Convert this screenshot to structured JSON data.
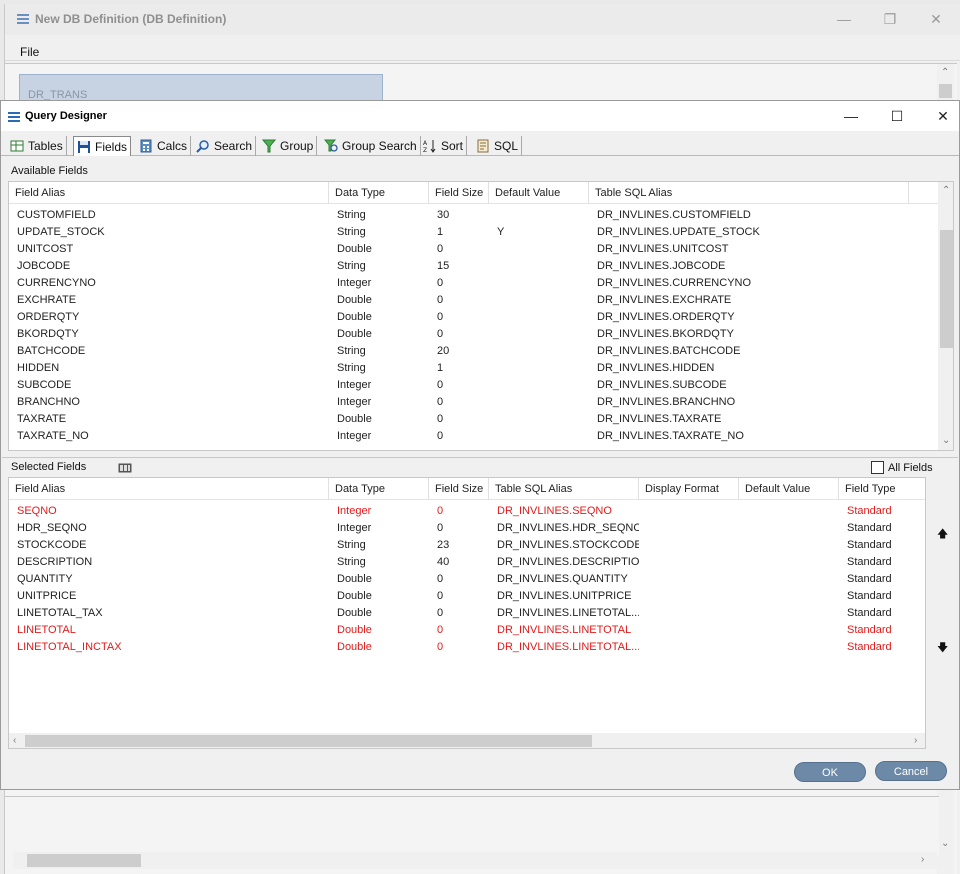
{
  "outer_window": {
    "title": "New DB Definition (DB Definition)",
    "menu_file": "File",
    "trans_box_text": "DR_TRANS"
  },
  "dialog": {
    "title": "Query Designer",
    "tabs": [
      {
        "label": "Tables",
        "icon": "tables-icon"
      },
      {
        "label": "Fields",
        "icon": "save-disk-icon"
      },
      {
        "label": "Calcs",
        "icon": "calculator-icon"
      },
      {
        "label": "Search",
        "icon": "magnifier-icon"
      },
      {
        "label": "Group",
        "icon": "filter-funnel-icon"
      },
      {
        "label": "Group Search",
        "icon": "filter-search-icon"
      },
      {
        "label": "Sort",
        "icon": "sort-az-icon"
      },
      {
        "label": "SQL",
        "icon": "sql-script-icon"
      }
    ],
    "active_tab": "Fields"
  },
  "available_fields": {
    "section_label": "Available Fields",
    "columns": [
      "Field Alias",
      "Data Type",
      "Field Size",
      "Default Value",
      "Table SQL Alias"
    ],
    "rows": [
      [
        "CUSTOMFIELD",
        "String",
        "30",
        "",
        "DR_INVLINES.CUSTOMFIELD"
      ],
      [
        "UPDATE_STOCK",
        "String",
        "1",
        "Y",
        "DR_INVLINES.UPDATE_STOCK"
      ],
      [
        "UNITCOST",
        "Double",
        "0",
        "",
        "DR_INVLINES.UNITCOST"
      ],
      [
        "JOBCODE",
        "String",
        "15",
        "",
        "DR_INVLINES.JOBCODE"
      ],
      [
        "CURRENCYNO",
        "Integer",
        "0",
        "",
        "DR_INVLINES.CURRENCYNO"
      ],
      [
        "EXCHRATE",
        "Double",
        "0",
        "",
        "DR_INVLINES.EXCHRATE"
      ],
      [
        "ORDERQTY",
        "Double",
        "0",
        "",
        "DR_INVLINES.ORDERQTY"
      ],
      [
        "BKORDQTY",
        "Double",
        "0",
        "",
        "DR_INVLINES.BKORDQTY"
      ],
      [
        "BATCHCODE",
        "String",
        "20",
        "",
        "DR_INVLINES.BATCHCODE"
      ],
      [
        "HIDDEN",
        "String",
        "1",
        "",
        "DR_INVLINES.HIDDEN"
      ],
      [
        "SUBCODE",
        "Integer",
        "0",
        "",
        "DR_INVLINES.SUBCODE"
      ],
      [
        "BRANCHNO",
        "Integer",
        "0",
        "",
        "DR_INVLINES.BRANCHNO"
      ],
      [
        "TAXRATE",
        "Double",
        "0",
        "",
        "DR_INVLINES.TAXRATE"
      ],
      [
        "TAXRATE_NO",
        "Integer",
        "0",
        "",
        "DR_INVLINES.TAXRATE_NO"
      ]
    ]
  },
  "selected_fields": {
    "section_label": "Selected Fields",
    "all_fields_label": "All Fields",
    "columns": [
      "Field Alias",
      "Data Type",
      "Field Size",
      "Table SQL Alias",
      "Display Format",
      "Default Value",
      "Field Type"
    ],
    "rows": [
      {
        "cells": [
          "SEQNO",
          "Integer",
          "0",
          "DR_INVLINES.SEQNO",
          "",
          "",
          "Standard"
        ],
        "highlight": true
      },
      {
        "cells": [
          "HDR_SEQNO",
          "Integer",
          "0",
          "DR_INVLINES.HDR_SEQNO",
          "",
          "",
          "Standard"
        ],
        "highlight": false
      },
      {
        "cells": [
          "STOCKCODE",
          "String",
          "23",
          "DR_INVLINES.STOCKCODE",
          "",
          "",
          "Standard"
        ],
        "highlight": false
      },
      {
        "cells": [
          "DESCRIPTION",
          "String",
          "40",
          "DR_INVLINES.DESCRIPTION",
          "",
          "",
          "Standard"
        ],
        "highlight": false
      },
      {
        "cells": [
          "QUANTITY",
          "Double",
          "0",
          "DR_INVLINES.QUANTITY",
          "",
          "",
          "Standard"
        ],
        "highlight": false
      },
      {
        "cells": [
          "UNITPRICE",
          "Double",
          "0",
          "DR_INVLINES.UNITPRICE",
          "",
          "",
          "Standard"
        ],
        "highlight": false
      },
      {
        "cells": [
          "LINETOTAL_TAX",
          "Double",
          "0",
          "DR_INVLINES.LINETOTAL...",
          "",
          "",
          "Standard"
        ],
        "highlight": false
      },
      {
        "cells": [
          "LINETOTAL",
          "Double",
          "0",
          "DR_INVLINES.LINETOTAL",
          "",
          "",
          "Standard"
        ],
        "highlight": true
      },
      {
        "cells": [
          "LINETOTAL_INCTAX",
          "Double",
          "0",
          "DR_INVLINES.LINETOTAL...",
          "",
          "",
          "Standard"
        ],
        "highlight": true
      }
    ]
  },
  "buttons": {
    "ok": "OK",
    "cancel": "Cancel"
  },
  "colors": {
    "highlight_row": "#e21b1b",
    "button": "#6c8aa8"
  }
}
